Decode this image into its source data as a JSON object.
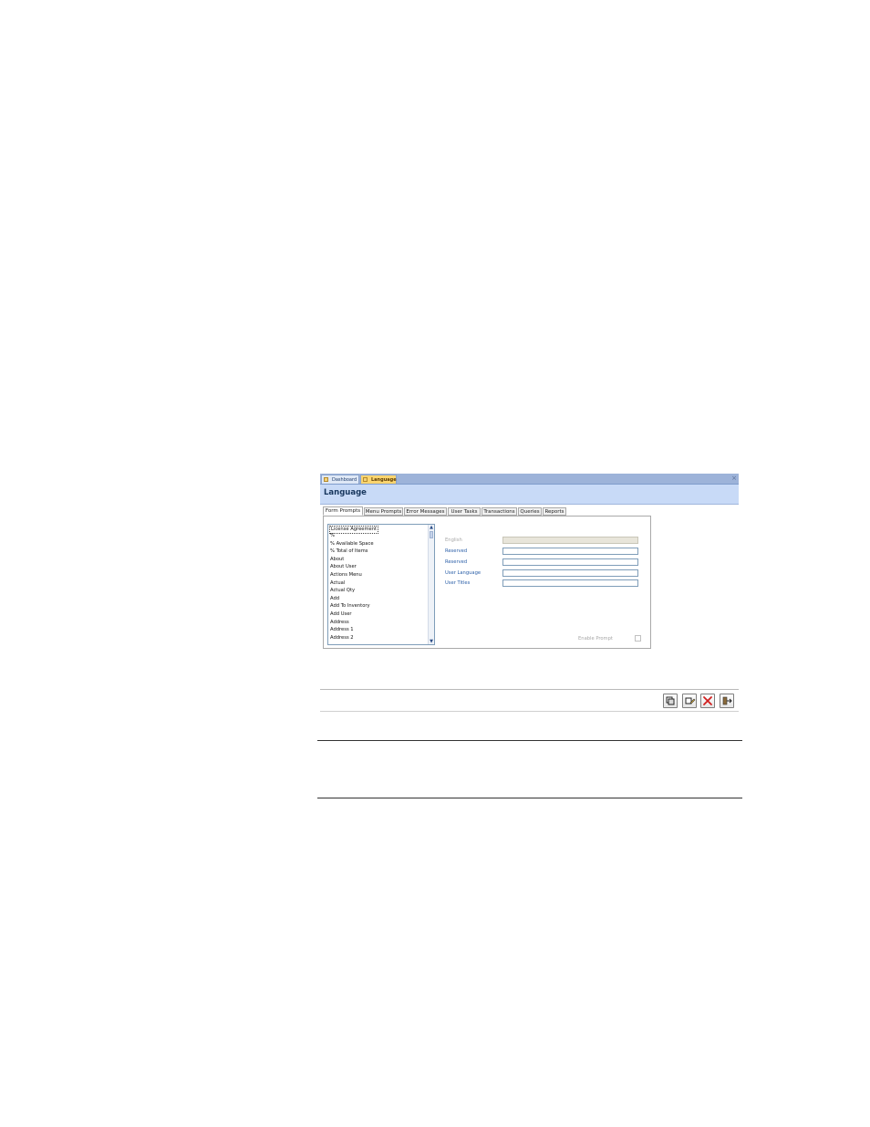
{
  "doc_tabs": {
    "dashboard": "Dashboard",
    "language": "Language",
    "close": "×"
  },
  "page_title": "Language",
  "sub_tabs": [
    "Form Prompts",
    "Menu Prompts",
    "Error Messages",
    "User Tasks",
    "Transactions",
    "Queries",
    "Reports"
  ],
  "list_items": [
    "License Agreement",
    "%",
    "% Available Space",
    "% Total of Items",
    "About",
    "About User",
    "Actions Menu",
    "Actual",
    "Actual Qty",
    "Add",
    "Add To Inventory",
    "Add User",
    "Address",
    "Address 1",
    "Address 2"
  ],
  "fields": {
    "english": {
      "label": "English",
      "value": ""
    },
    "reserved_1": {
      "label": "Reserved",
      "value": ""
    },
    "reserved_2": {
      "label": "Reserved",
      "value": ""
    },
    "user_language": {
      "label": "User Language",
      "value": ""
    },
    "user_titles": {
      "label": "User Titles",
      "value": ""
    }
  },
  "enable_prompt": {
    "label": "Enable Prompt",
    "checked": false
  },
  "toolbar_icons": [
    "copy-icon",
    "edit-icon",
    "delete-icon",
    "exit-icon"
  ],
  "colors": {
    "tab_strip": "#9db3d9",
    "title_bar": "#c8daf7",
    "active_tab": "#fbd56f",
    "label_blue": "#2b5fa8",
    "delete_red": "#d11f1f"
  }
}
